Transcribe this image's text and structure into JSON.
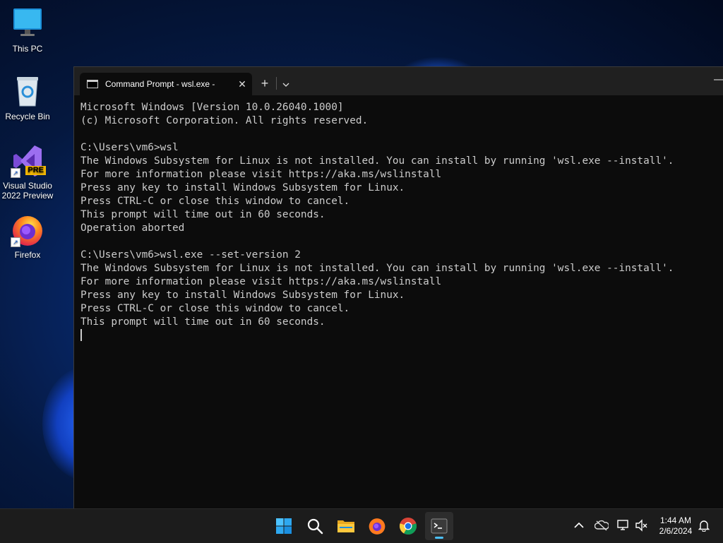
{
  "desktop": {
    "icons": [
      {
        "label": "This PC"
      },
      {
        "label": "Recycle Bin"
      },
      {
        "label": "Visual Studio\n2022 Preview",
        "line1": "Visual Studio",
        "line2": "2022 Preview",
        "badge": "PRE"
      },
      {
        "label": "Firefox"
      }
    ]
  },
  "terminal": {
    "tab_title": "Command Prompt - wsl.exe -",
    "tab_close": "✕",
    "new_tab": "+",
    "dropdown": "⌄",
    "minimize": "—",
    "lines": [
      "Microsoft Windows [Version 10.0.26040.1000]",
      "(c) Microsoft Corporation. All rights reserved.",
      "",
      "C:\\Users\\vm6>wsl",
      "The Windows Subsystem for Linux is not installed. You can install by running 'wsl.exe --install'.",
      "For more information please visit https://aka.ms/wslinstall",
      "Press any key to install Windows Subsystem for Linux.",
      "Press CTRL-C or close this window to cancel.",
      "This prompt will time out in 60 seconds.",
      "Operation aborted",
      "",
      "C:\\Users\\vm6>wsl.exe --set-version 2",
      "The Windows Subsystem for Linux is not installed. You can install by running 'wsl.exe --install'.",
      "For more information please visit https://aka.ms/wslinstall",
      "Press any key to install Windows Subsystem for Linux.",
      "Press CTRL-C or close this window to cancel.",
      "This prompt will time out in 60 seconds."
    ]
  },
  "taskbar": {
    "apps": [
      "start-icon",
      "search-icon",
      "file-explorer-icon",
      "firefox-icon",
      "chrome-icon",
      "terminal-icon"
    ],
    "tray": [
      "chevron-up-icon",
      "onedrive-icon",
      "network-icon",
      "volume-icon"
    ],
    "time": "1:44 AM",
    "date": "2/6/2024"
  },
  "colors": {
    "terminal_bg": "#0c0c0c",
    "terminal_fg": "#cccccc",
    "tabbar_bg": "#202020",
    "taskbar_bg": "#1c1c1c",
    "accent": "#4cc2ff"
  }
}
